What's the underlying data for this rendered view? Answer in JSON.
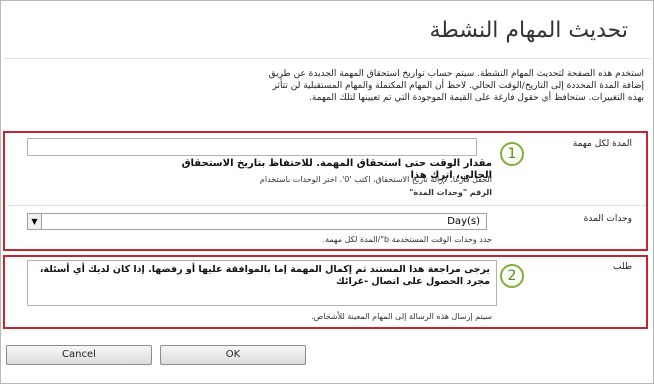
{
  "page": {
    "title": "تحديث المهام النشطة",
    "intro": "استخدم هذه الصفحة لتحديث المهام النشطة. سيتم حساب تواريخ استحقاق المهمة الجديدة عن طريق إضافة المدة المحددة إلى التاريخ/الوقت الحالي. لاحظ أن المهام المكتملة والمهام المستقبلية لن تتأثر بهذه التغييرات. ستحافظ أي حقول فارغة على القيمة الموجودة التي تم تعيينها لتلك المهمة."
  },
  "duration": {
    "label": "المدة لكل مهمة",
    "step_number": "1",
    "input_value": "",
    "help_bold": "مقدار الوقت حتى استحقاق المهمة. للاحتفاظ بتاريخ الاستحقاق الحالي، اترك هذا",
    "help_line2": "الحقل فارغا. لإزالة تاريخ الاستحقاق، اكتب           '0'. اختر الوحدات باستخدام",
    "help_line3": "الرقم \"وحدات المدة\""
  },
  "units": {
    "label": "وحدات المدة",
    "selected": "Day(s)",
    "help": "حدد وحدات الوقت المستخدمة b\"/المدة لكل مهمة."
  },
  "request": {
    "label": "طلب",
    "step_number": "2",
    "textarea_value": "يرجى مراجعة هذا المستند ثم إكمال المهمة إما بالموافقة عليها أو رفضها. إذا كان لديك أي أسئلة، مجرد الحصول على اتصال -غرائك",
    "help": "سيتم إرسال هذه الرسالة إلى المهام المعينة للأشخاص."
  },
  "buttons": {
    "ok": "OK",
    "cancel": "Cancel"
  },
  "colors": {
    "section_border": "#c8262f",
    "step_circle": "#7fae3a"
  }
}
